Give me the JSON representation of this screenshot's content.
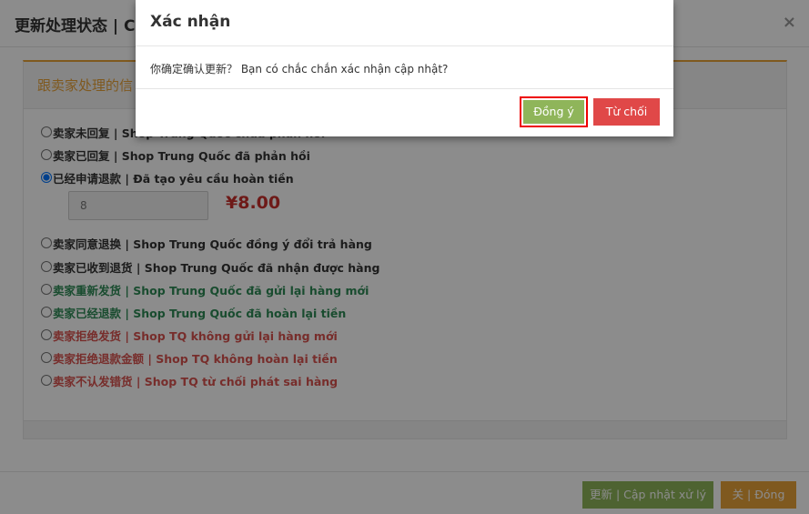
{
  "page": {
    "title": "更新处理状态 | C",
    "close_glyph": "×",
    "panel_heading": "跟卖家处理的信",
    "options": [
      {
        "label": "卖家未回复 | Shop Trung Quốc chưa phản hồi",
        "checked": false,
        "tone": "dark"
      },
      {
        "label": "卖家已回复 | Shop Trung Quốc đã phản hồi",
        "checked": false,
        "tone": "dark"
      },
      {
        "label": "已经申请退款 | Đã tạo yêu cầu hoàn tiền",
        "checked": true,
        "tone": "dark"
      },
      {
        "label": "卖家同意退换 | Shop Trung Quốc đồng ý đổi trả hàng",
        "checked": false,
        "tone": "dark"
      },
      {
        "label": "卖家已收到退货 | Shop Trung Quốc đã nhận được hàng",
        "checked": false,
        "tone": "dark"
      },
      {
        "label": "卖家重新发货 | Shop Trung Quốc đã gửi lại hàng mới",
        "checked": false,
        "tone": "green"
      },
      {
        "label": "卖家已经退款 | Shop Trung Quốc đã hoàn lại tiền",
        "checked": false,
        "tone": "green"
      },
      {
        "label": "卖家拒绝发货 | Shop TQ không gửi lại hàng mới",
        "checked": false,
        "tone": "red"
      },
      {
        "label": "卖家拒绝退款金额 | Shop TQ không hoàn lại tiền",
        "checked": false,
        "tone": "red"
      },
      {
        "label": "卖家不认发错货 | Shop TQ từ chối phát sai hàng",
        "checked": false,
        "tone": "red"
      }
    ],
    "refund_input_value": "8",
    "refund_amount_text": "¥8.00",
    "update_button": "更新 | Cập nhật xử lý",
    "close_button": "关 | Đóng"
  },
  "modal": {
    "title": "Xác nhận",
    "message": "你确定确认更新？ Bạn có chắc chắn xác nhận cập nhật?",
    "agree_button": "Đồng ý",
    "reject_button": "Từ chối"
  },
  "colors": {
    "accent_orange": "#e8a23a",
    "green_button": "#8fb55a",
    "red_button": "#e04848",
    "highlight_border": "#e00000"
  }
}
